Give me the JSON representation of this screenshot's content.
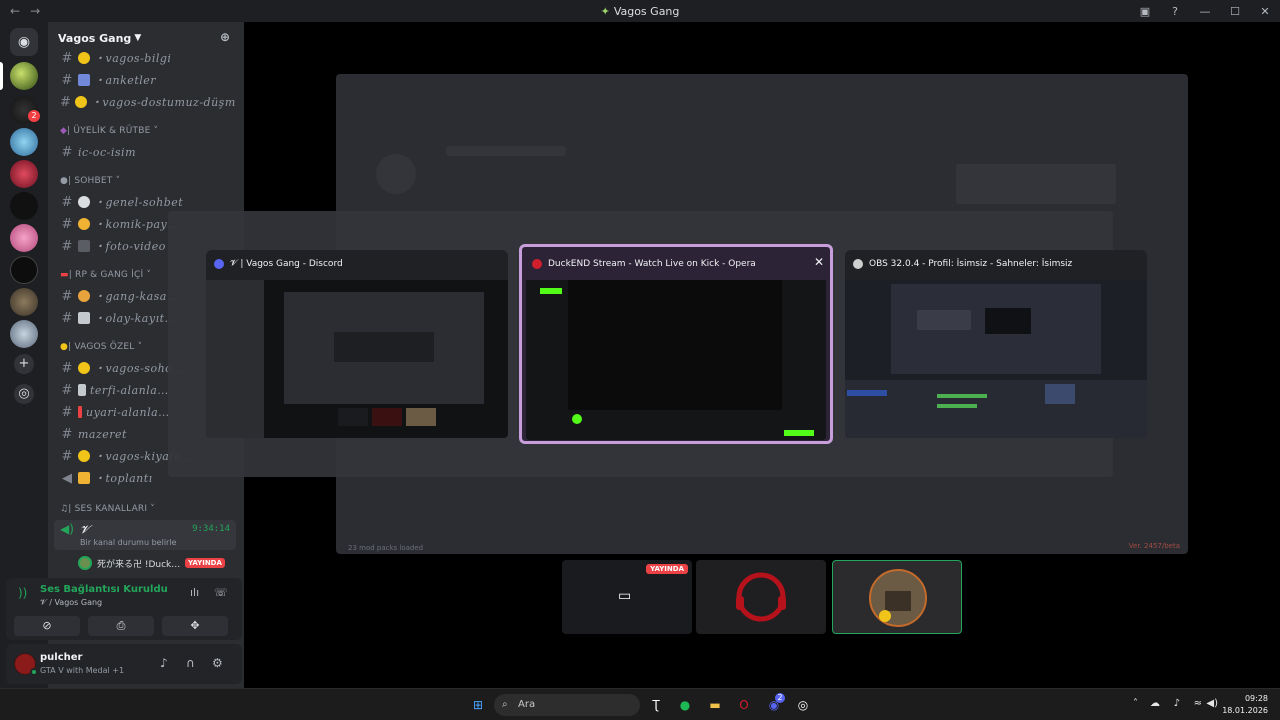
{
  "titlebar": {
    "title": "Vagos Gang",
    "back": "←",
    "forward": "→"
  },
  "guild": {
    "name": "Vagos Gang"
  },
  "categories": {
    "uyelik": "| ÜYELİK & RÜTBE",
    "sohbet": "| SOHBET",
    "rp": "| RP & GANG İÇİ",
    "ozel": "| VAGOS ÖZEL",
    "ses": "| SES KANALLARI"
  },
  "channels": [
    {
      "name": "・vagos-bilgi",
      "emoji_color": "#f0c419"
    },
    {
      "name": "・anketler",
      "emoji_color": "#7289da"
    },
    {
      "name": "・vagos-dostumuz-düşm…",
      "emoji_color": "#f0c419"
    },
    {
      "name": "ic-oc-isim",
      "emoji_color": ""
    },
    {
      "name": "・genel-sohbet",
      "emoji_color": "#dbdee1"
    },
    {
      "name": "・komik-pay…",
      "emoji_color": "#f0b232"
    },
    {
      "name": "・foto-video",
      "emoji_color": "#5a5d63"
    },
    {
      "name": "・gang-kasa…",
      "emoji_color": "#e8a33d"
    },
    {
      "name": "・olay-kayıt…",
      "emoji_color": "#c4c9ce"
    },
    {
      "name": "・vagos-soho…",
      "emoji_color": "#f0c419"
    },
    {
      "name": "terfi-alanla…",
      "emoji_color": "#c4c9ce"
    },
    {
      "name": "uyari-alanla…",
      "emoji_color": "#ed4245"
    },
    {
      "name": "mazeret",
      "emoji_color": ""
    },
    {
      "name": "・vagos-kiyafe…",
      "emoji_color": "#f0c419"
    },
    {
      "name": "・toplantı",
      "emoji_color": "#f0b232"
    }
  ],
  "voice": {
    "channel": "𝓥",
    "time": "9:34:14",
    "status_hint": "Bir kanal durumu belirle",
    "user": "死が来る卍 !Duck…",
    "live": "YAYINDA"
  },
  "voice_panel": {
    "status": "Ses Bağlantısı Kuruldu",
    "location": "𝓥 / Vagos Gang"
  },
  "user_panel": {
    "name": "pulcher",
    "activity": "GTA V with Medal +1"
  },
  "badges": {
    "server2": "2",
    "discord": "2"
  },
  "alt_tab": [
    {
      "title": "𝓥 | Vagos Gang - Discord",
      "icon_color": "#5865f2",
      "selected": false
    },
    {
      "title": "DuckEND Stream - Watch Live on Kick - Opera",
      "icon_color": "#d21f2e",
      "selected": true,
      "close": "✕"
    },
    {
      "title": "OBS 32.0.4 - Profil: İsimsiz - Sahneler: İsimsiz",
      "icon_color": "#cfcfcf",
      "selected": false
    }
  ],
  "shared_screen": {
    "footer_left": "23 mod packs loaded",
    "footer_right": "Ver. 2457/beta"
  },
  "tiles": {
    "live": "YAYINDA"
  },
  "taskbar": {
    "search": "Ara",
    "time": "09:28",
    "date": "18.01.2026"
  },
  "colors": {
    "accent": "#5865f2",
    "green": "#23a55a",
    "live": "#ed4245",
    "selection": "#c89ddb"
  },
  "icons": [
    "discord-icon",
    "search-icon",
    "spotify-icon",
    "kick-icon",
    "obs-icon",
    "opera-icon",
    "windows-start-icon"
  ]
}
